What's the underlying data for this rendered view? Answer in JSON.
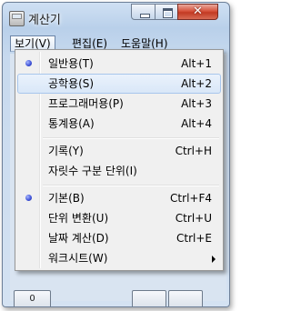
{
  "window": {
    "title": "계산기",
    "close_glyph": "✕"
  },
  "menubar": {
    "items": [
      {
        "label": "보기(V)"
      },
      {
        "label": "편집(E)"
      },
      {
        "label": "도움말(H)"
      }
    ]
  },
  "view_menu": {
    "items": [
      {
        "label": "일반용(T)",
        "shortcut": "Alt+1",
        "checked": true
      },
      {
        "label": "공학용(S)",
        "shortcut": "Alt+2",
        "highlighted": true
      },
      {
        "label": "프로그래머용(P)",
        "shortcut": "Alt+3"
      },
      {
        "label": "통계용(A)",
        "shortcut": "Alt+4"
      },
      {
        "label": "기록(Y)",
        "shortcut": "Ctrl+H"
      },
      {
        "label": "자릿수 구분 단위(I)",
        "shortcut": ""
      },
      {
        "label": "기본(B)",
        "shortcut": "Ctrl+F4",
        "checked": true
      },
      {
        "label": "단위 변환(U)",
        "shortcut": "Ctrl+U"
      },
      {
        "label": "날짜 계산(D)",
        "shortcut": "Ctrl+E"
      },
      {
        "label": "워크시트(W)",
        "shortcut": "",
        "submenu": true
      }
    ]
  },
  "background": {
    "partial_key_label": "0"
  },
  "icons": {
    "app": "calculator-icon",
    "radio": "radio-bullet-icon",
    "submenu": "submenu-arrow-icon"
  }
}
